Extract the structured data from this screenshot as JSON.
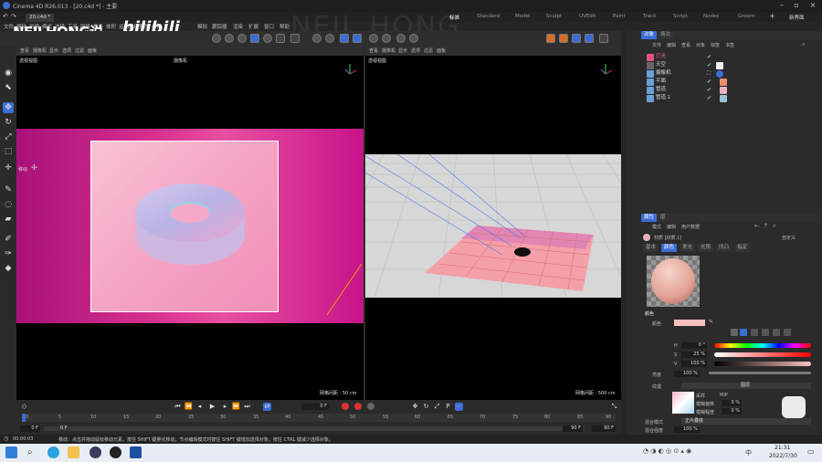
{
  "window": {
    "title": "Cinema 4D R26.013 - [20.c4d *] - 主要"
  },
  "file_tabs": [
    {
      "label": "20.c4d *"
    }
  ],
  "layouts": [
    "标准",
    "Standard",
    "Model",
    "Sculpt",
    "UVEdit",
    "Paint",
    "Track",
    "Script",
    "Nodes",
    "Groom"
  ],
  "layout_new": "新界面",
  "watermark": {
    "author": "NEILHONG说",
    "site": "bilibili",
    "big": "NEIL HONG"
  },
  "menu": [
    "文件",
    "编辑",
    "创建",
    "模式",
    "选择",
    "工具",
    "网格",
    "样条",
    "体积",
    "运动图形",
    "角色",
    "动画",
    "模拟",
    "跟踪器",
    "渲染",
    "扩展",
    "窗口",
    "帮助"
  ],
  "viewport_left": {
    "menu": [
      "查看",
      "摄像机",
      "显示",
      "选项",
      "过滤",
      "面板"
    ],
    "title": "透视视图",
    "camera": "摄像机",
    "move_label": "移动",
    "grid_note": "网格间距 : 50 cm"
  },
  "viewport_right": {
    "menu": [
      "查看",
      "摄像机",
      "显示",
      "选项",
      "过滤",
      "面板"
    ],
    "title": "透视视图",
    "camera": "摄像机",
    "grid_note": "网格间距 : 500 cm"
  },
  "object_panel": {
    "tabs": [
      "对象",
      "场次"
    ],
    "menu": [
      "文件",
      "编辑",
      "查看",
      "对象",
      "标签",
      "书签"
    ],
    "objects": [
      {
        "name": "灯光",
        "color": "#e3508a"
      },
      {
        "name": "天空",
        "color": "#bbbbbb"
      },
      {
        "name": "摄像机",
        "color": "#bbbbbb"
      },
      {
        "name": "平面",
        "color": "#bbbbbb"
      },
      {
        "name": "管道",
        "color": "#bbbbbb"
      },
      {
        "name": "管道.1",
        "color": "#bbbbbb"
      }
    ]
  },
  "attr_panel": {
    "title": "属性",
    "tabs2": [
      "层"
    ],
    "menu": [
      "模式",
      "编辑",
      "用户数据"
    ],
    "material": "材质 [材质.1]",
    "custom": "自定义",
    "tabs": [
      "基本",
      "颜色",
      "发光",
      "光照",
      "凹凸",
      "指定"
    ],
    "section": "颜色",
    "color_label": "颜色",
    "h_label": "H",
    "h_val": "0 °",
    "s_label": "S",
    "s_val": "25 %",
    "v_label": "V",
    "v_val": "100 %",
    "brightness_label": "亮度",
    "brightness_val": "100 %",
    "texture_label": "纹理",
    "texture_val": "图层",
    "sample": "采样",
    "sample_val": "MIP",
    "blur_offset": "模糊偏移",
    "blur_offset_val": "0 %",
    "blur_scale": "模糊程度",
    "blur_scale_val": "0 %",
    "mix_mode": "混合模式",
    "mix_val": "正片叠底",
    "mix_strength": "混合强度",
    "mix_strength_val": "100 %"
  },
  "timeline": {
    "frame": "0 F",
    "start": "0 F",
    "end": "90 F",
    "end2": "90 F",
    "current": "0 F",
    "ticks": [
      "0",
      "5",
      "10",
      "15",
      "20",
      "25",
      "30",
      "35",
      "40",
      "45",
      "50",
      "55",
      "60",
      "65",
      "70",
      "75",
      "80",
      "85",
      "90"
    ]
  },
  "status": {
    "time": "00:00:03",
    "text": "移动：点击并拖动鼠标移动元素。按住 SHIFT 键量化移动；节点编辑模式时按住 SHIFT 键增加选择对象；按住 CTRL 键减少选择对象。"
  },
  "taskbar": {
    "time": "21:31",
    "date": "2022/7/30",
    "lang": "中"
  },
  "colors": {
    "accent": "#3a6dd6",
    "magenta": "#c0107e",
    "pink": "#f7a7c0"
  }
}
